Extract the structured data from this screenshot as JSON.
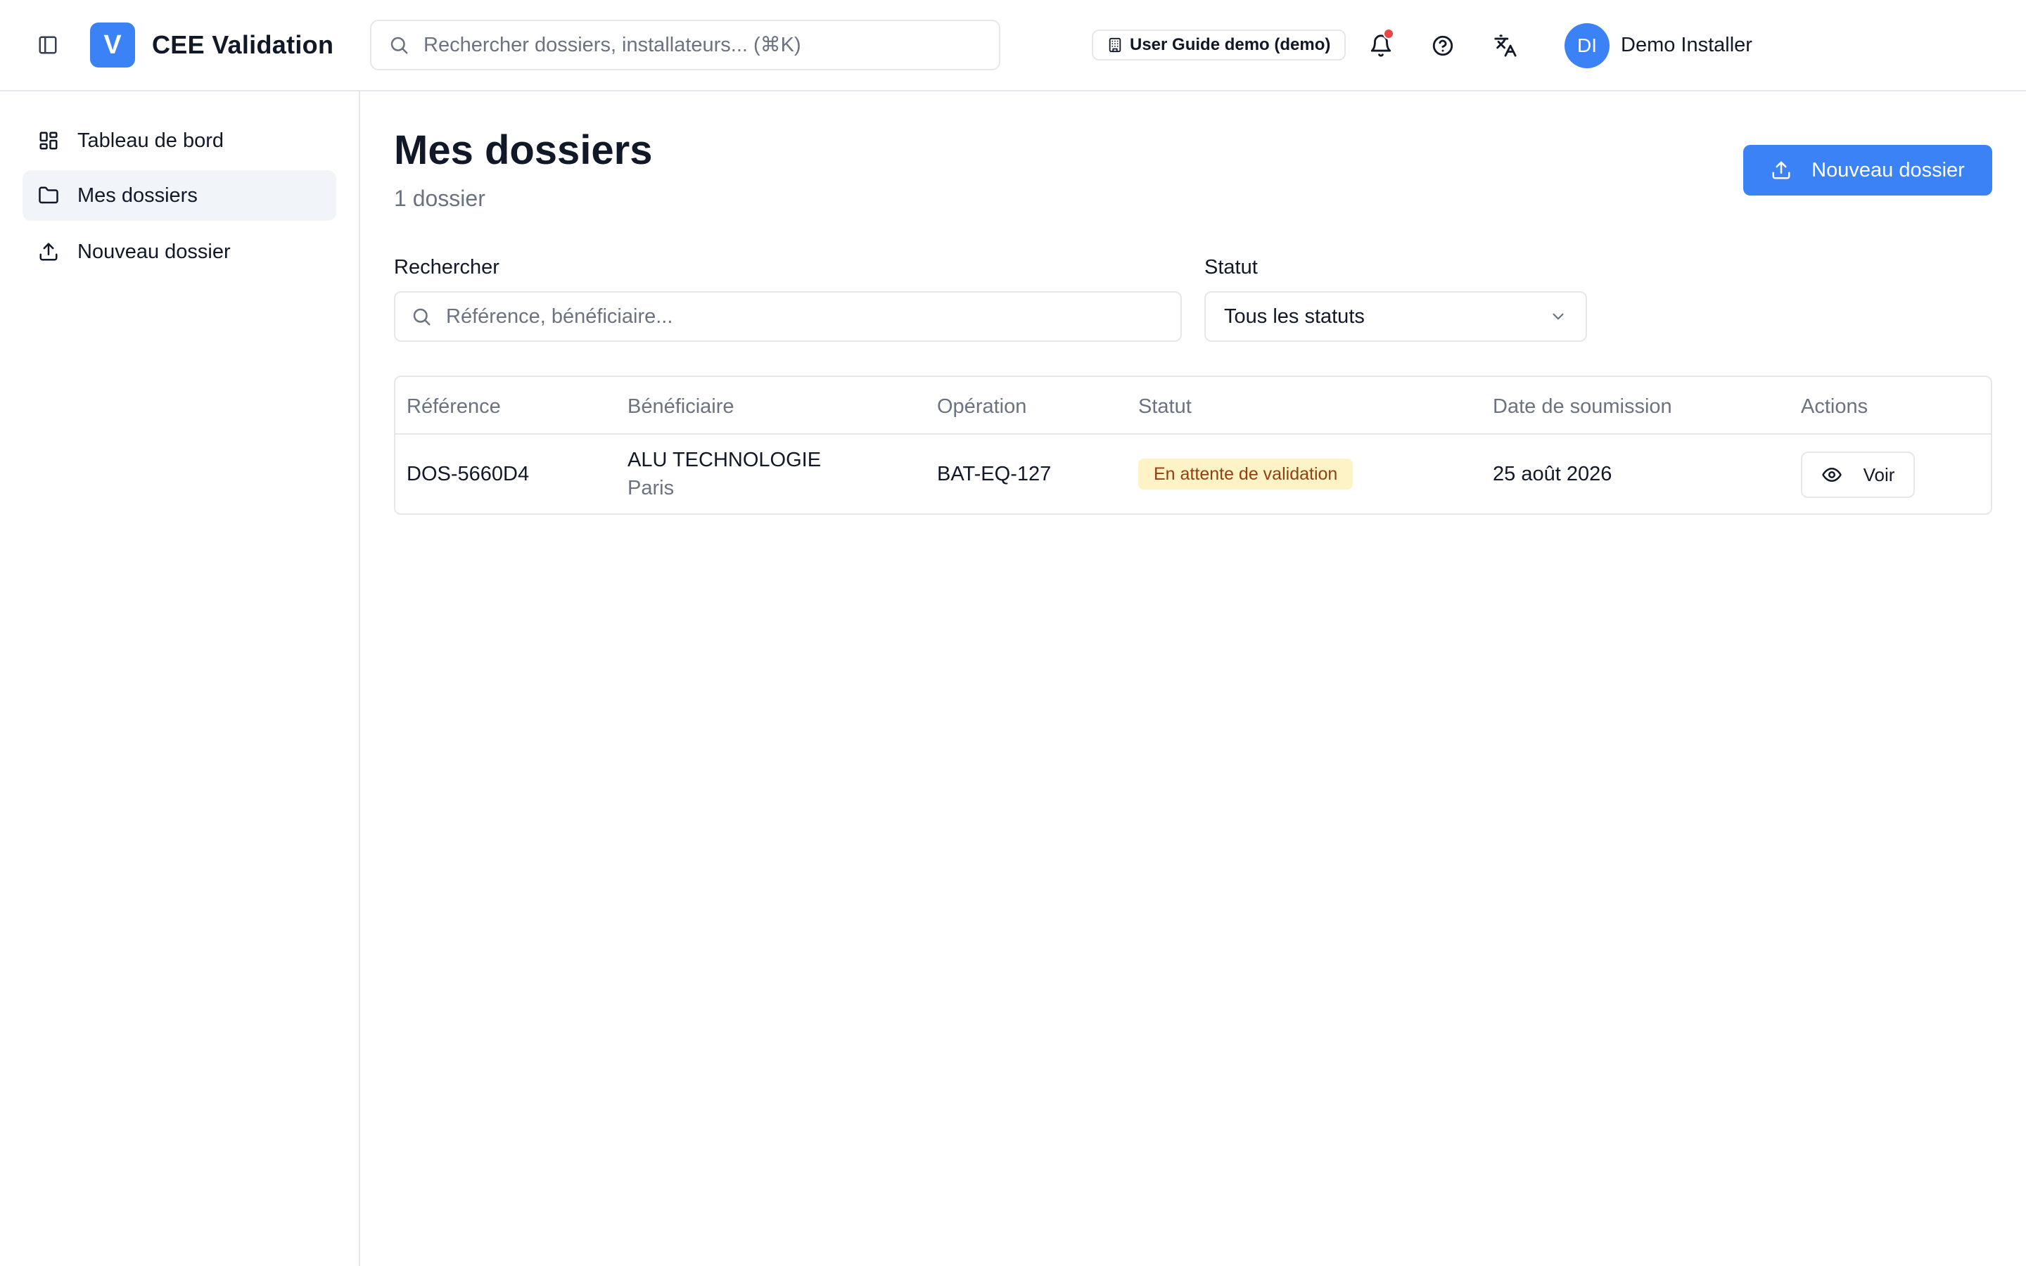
{
  "app": {
    "logo_letter": "V",
    "title": "CEE Validation"
  },
  "header": {
    "search_placeholder": "Rechercher dossiers, installateurs... (⌘K)",
    "tenant_label": "User Guide demo (demo)",
    "user_initials": "DI",
    "user_name": "Demo Installer",
    "has_notification": true,
    "icons": [
      "sidebar-toggle-icon",
      "search-icon",
      "building-icon",
      "bell-icon",
      "help-icon",
      "translate-icon"
    ]
  },
  "sidebar": {
    "items": [
      {
        "label": "Tableau de bord",
        "icon": "dashboard-icon",
        "active": false
      },
      {
        "label": "Mes dossiers",
        "icon": "folder-icon",
        "active": true
      },
      {
        "label": "Nouveau dossier",
        "icon": "upload-icon",
        "active": false
      }
    ]
  },
  "main": {
    "title": "Mes dossiers",
    "subtitle": "1 dossier",
    "new_button_label": "Nouveau dossier",
    "filters": {
      "search_label": "Rechercher",
      "search_placeholder": "Référence, bénéficiaire...",
      "status_label": "Statut",
      "status_value": "Tous les statuts"
    },
    "table": {
      "columns": [
        "Référence",
        "Bénéficiaire",
        "Opération",
        "Statut",
        "Date de soumission",
        "Actions"
      ],
      "rows": [
        {
          "reference": "DOS-5660D4",
          "beneficiary": "ALU TECHNOLOGIE",
          "city": "Paris",
          "operation": "BAT-EQ-127",
          "status": "En attente de validation",
          "date": "25 août 2026",
          "action_label": "Voir"
        }
      ]
    }
  },
  "colors": {
    "accent": "#3b82f6",
    "notification": "#ef4444",
    "pending_badge_bg": "#fef3c7",
    "pending_badge_text": "#92400e"
  }
}
